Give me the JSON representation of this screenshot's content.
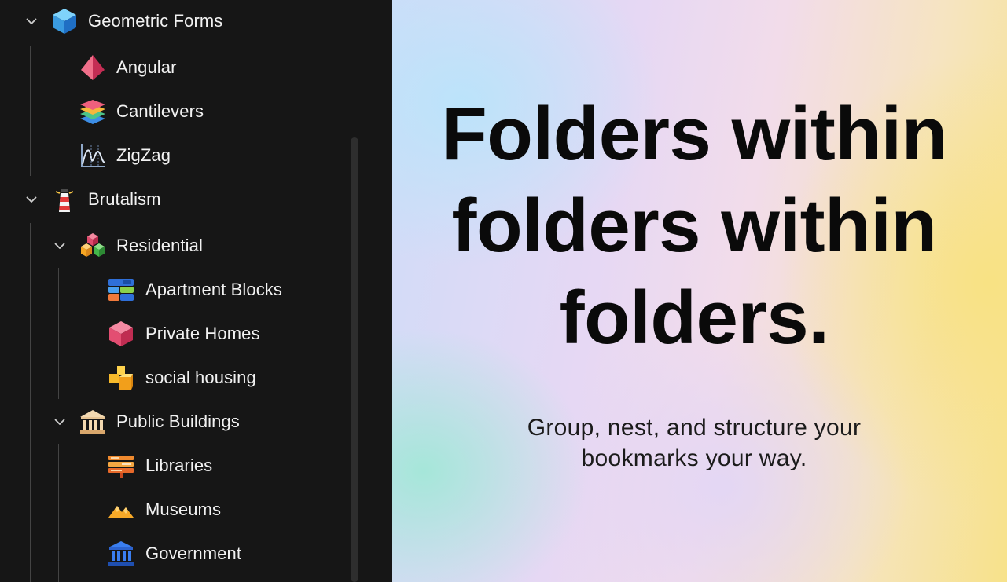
{
  "sidebar": {
    "geometric_forms": {
      "label": "Geometric Forms",
      "icon": "cube-blue-icon"
    },
    "angular": {
      "label": "Angular",
      "icon": "pyramid-icon"
    },
    "cantilevers": {
      "label": "Cantilevers",
      "icon": "layers-icon"
    },
    "zigzag": {
      "label": "ZigZag",
      "icon": "zigzag-chart-icon"
    },
    "brutalism": {
      "label": "Brutalism",
      "icon": "lighthouse-icon"
    },
    "residential": {
      "label": "Residential",
      "icon": "stacked-cubes-icon"
    },
    "apartment_blocks": {
      "label": "Apartment Blocks",
      "icon": "blocks-grid-icon"
    },
    "private_homes": {
      "label": "Private Homes",
      "icon": "cube-pink-icon"
    },
    "social_housing": {
      "label": "social housing",
      "icon": "yellow-blocks-icon"
    },
    "public_buildings": {
      "label": "Public Buildings",
      "icon": "classical-building-icon"
    },
    "libraries": {
      "label": "Libraries",
      "icon": "books-shelf-icon"
    },
    "museums": {
      "label": "Museums",
      "icon": "mountains-icon"
    },
    "government": {
      "label": "Government",
      "icon": "bank-building-icon"
    }
  },
  "hero": {
    "headline_line1": "Folders within",
    "headline_line2": "folders within",
    "headline_line3": "folders.",
    "subtitle_line1": "Group, nest, and structure your",
    "subtitle_line2": "bookmarks your way."
  },
  "colors": {
    "sidebar_bg": "#161616",
    "text_light": "#f2f2f2",
    "headline": "#0a0a0a"
  }
}
